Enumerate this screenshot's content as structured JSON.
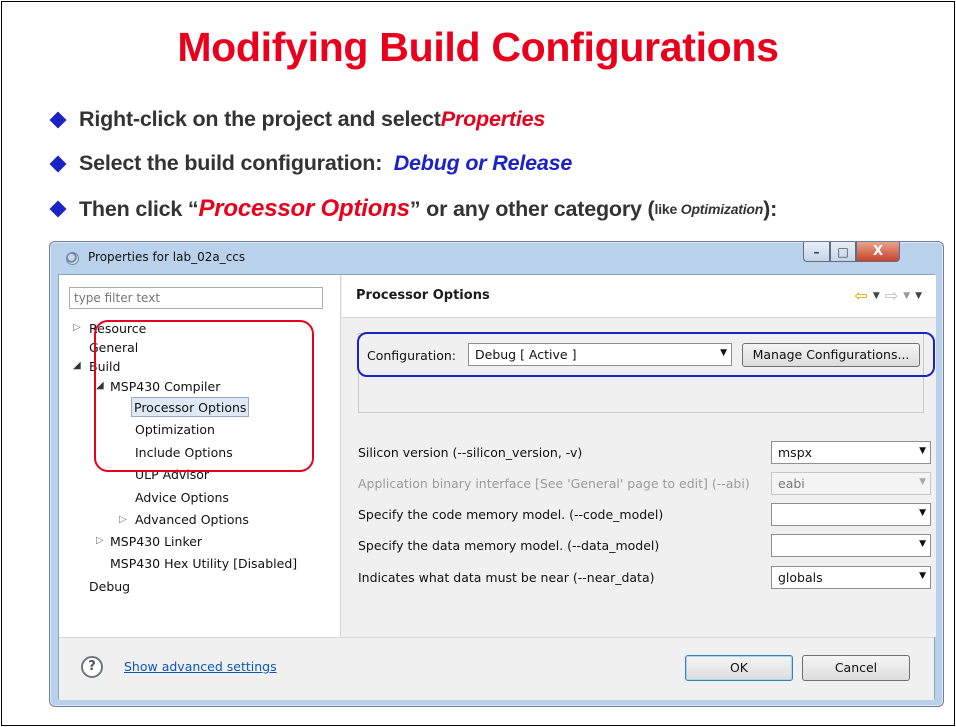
{
  "slide": {
    "title": "Modifying Build Configurations",
    "bullets": [
      {
        "text": "Right-click on the project and select ",
        "emphasis": "Properties"
      },
      {
        "text": "Select the build configuration:  ",
        "emphasis": "Debug or Release"
      },
      {
        "prefix": "Then click “",
        "emphasis": "Processor Options",
        "middle": "” or any other category (",
        "small_like": "like ",
        "small_em": "Optimization",
        "suffix": "):"
      }
    ]
  },
  "dialog": {
    "title": "Properties for lab_02a_ccs",
    "window_buttons": {
      "minimize": "–",
      "maximize": "□",
      "close": "X"
    },
    "filter_placeholder": "type filter text",
    "tree": {
      "resource": "Resource",
      "general": "General",
      "build": "Build",
      "msp430_compiler": "MSP430 Compiler",
      "processor_options": "Processor Options",
      "optimization": "Optimization",
      "include_options": "Include Options",
      "ulp_advisor": "ULP Advisor",
      "advice_options": "Advice Options",
      "advanced_options": "Advanced Options",
      "msp430_linker": "MSP430 Linker",
      "hex_utility": "MSP430 Hex Utility  [Disabled]",
      "debug": "Debug"
    },
    "panel_title": "Processor Options",
    "configuration": {
      "label": "Configuration:",
      "value": "Debug  [ Active ]",
      "manage_button": "Manage Configurations..."
    },
    "options": [
      {
        "label": "Silicon version (--silicon_version, -v)",
        "value": "mspx",
        "enabled": true
      },
      {
        "label": "Application binary interface [See 'General' page to edit] (--abi)",
        "value": "eabi",
        "enabled": false
      },
      {
        "label": "Specify the code memory model. (--code_model)",
        "value": "",
        "enabled": true
      },
      {
        "label": "Specify the data memory model. (--data_model)",
        "value": "",
        "enabled": true
      },
      {
        "label": "Indicates what data must be near (--near_data)",
        "value": "globals",
        "enabled": true
      }
    ],
    "footer": {
      "help_icon": "?",
      "advanced_link": "Show advanced settings",
      "ok": "OK",
      "cancel": "Cancel"
    }
  },
  "colors": {
    "title_red": "#e8001c",
    "bullet_blue": "#1a22c8",
    "highlight_red_outline": "#e8001c",
    "highlight_blue_outline": "#1a22c8"
  },
  "icons": [
    "diamond-bullet-icon",
    "app-icon",
    "minimize-icon",
    "maximize-icon",
    "close-icon",
    "back-arrow-icon",
    "forward-arrow-icon",
    "menu-caret-icon",
    "tree-expand-icon",
    "tree-collapse-icon",
    "dropdown-arrow-icon",
    "help-icon"
  ]
}
